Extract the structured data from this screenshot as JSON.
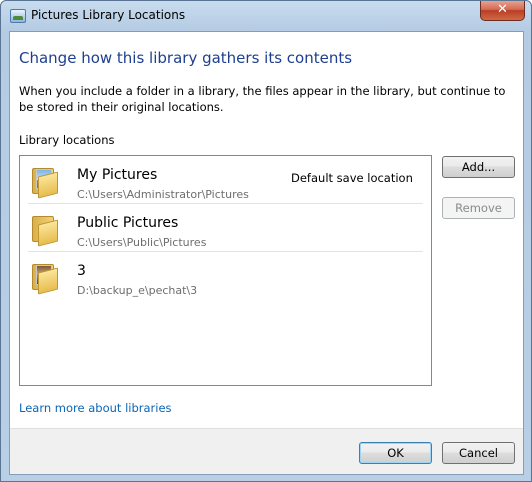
{
  "window": {
    "title": "Pictures Library Locations",
    "close_glyph": "✕"
  },
  "content": {
    "heading": "Change how this library gathers its contents",
    "description": "When you include a folder in a library, the files appear in the library, but continue to be stored in their original locations.",
    "locations_label": "Library locations",
    "learn_more_link": "Learn more about libraries"
  },
  "locations": [
    {
      "name": "My Pictures",
      "path": "C:\\Users\\Administrator\\Pictures",
      "default_label": "Default save location",
      "icon": "folder-pictures-icon"
    },
    {
      "name": "Public Pictures",
      "path": "C:\\Users\\Public\\Pictures",
      "default_label": "",
      "icon": "folder-icon"
    },
    {
      "name": "3",
      "path": "D:\\backup_e\\pechat\\3",
      "default_label": "",
      "icon": "folder-photo-icon"
    }
  ],
  "buttons": {
    "add": "Add...",
    "remove": "Remove",
    "ok": "OK",
    "cancel": "Cancel"
  },
  "colors": {
    "heading": "#1e3f90",
    "link": "#0a66b7",
    "close_button": "#c9432c"
  }
}
